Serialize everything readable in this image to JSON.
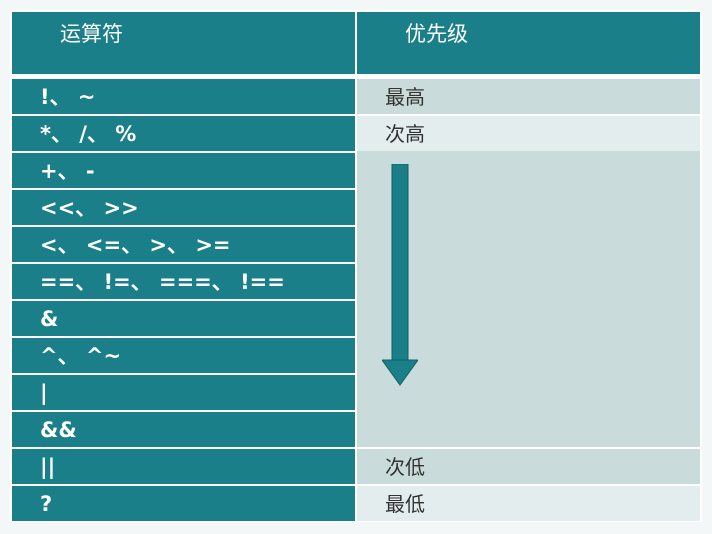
{
  "header": {
    "operator_label": "运算符",
    "priority_label": "优先级"
  },
  "rows": [
    {
      "operator": "!、 ~",
      "priority": "最高"
    },
    {
      "operator": "*、 /、 %",
      "priority": "次高"
    },
    {
      "operator": "+、 -",
      "priority": ""
    },
    {
      "operator": "<<、 >>",
      "priority": ""
    },
    {
      "operator": "<、 <=、 >、 >=",
      "priority": ""
    },
    {
      "operator": "==、 !=、 ===、 !==",
      "priority": ""
    },
    {
      "operator": "&",
      "priority": ""
    },
    {
      "operator": "^、 ^~",
      "priority": ""
    },
    {
      "operator": "|",
      "priority": ""
    },
    {
      "operator": "&&",
      "priority": ""
    },
    {
      "operator": "||",
      "priority": "次低"
    },
    {
      "operator": "?",
      "priority": "最低"
    }
  ],
  "indicator": {
    "icon": "down-arrow-icon"
  },
  "colors": {
    "header_bg": "#1a7f88",
    "cell_dark": "#c9dcdb",
    "cell_light": "#e3eded"
  }
}
